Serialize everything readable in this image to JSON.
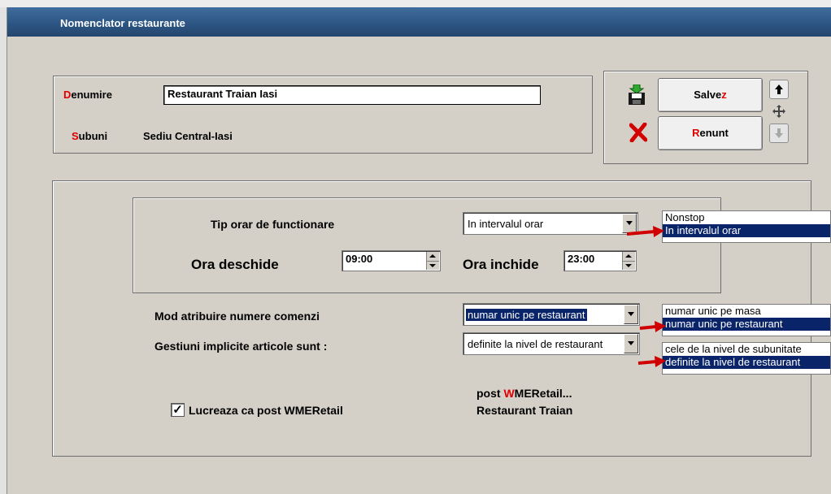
{
  "window": {
    "title": "Nomenclator restaurante"
  },
  "header": {
    "denumire_label_first": "D",
    "denumire_label_rest": "enumire",
    "denumire_value": "Restaurant Traian Iasi",
    "subuni_label_first": "S",
    "subuni_label_mid": "u",
    "subuni_label_rest": "buni",
    "subuni_value": "Sediu Central-Iasi"
  },
  "actions": {
    "save_label_main": "Salve",
    "save_label_hotkey": "z",
    "cancel_label_hotkey": "R",
    "cancel_label_main": "enunt"
  },
  "schedule": {
    "tip_orar_label": "Tip orar de functionare",
    "tip_orar_selected": "In intervalul orar",
    "tip_orar_options": [
      "Nonstop",
      "In intervalul orar"
    ],
    "ora_deschide_label": "Ora deschide",
    "ora_deschide_value": "09:00",
    "ora_inchide_label": "Ora inchide",
    "ora_inchide_value": "23:00"
  },
  "orders": {
    "mod_atribuire_label": "Mod atribuire numere comenzi",
    "mod_atribuire_selected": "numar unic pe restaurant",
    "mod_atribuire_options": [
      "numar unic pe masa",
      "numar unic pe restaurant"
    ],
    "gestiuni_label": "Gestiuni implicite articole sunt  :",
    "gestiuni_selected": "definite la nivel de restaurant",
    "gestiuni_options": [
      "cele de la nivel de subunitate",
      "definite la nivel de restaurant"
    ]
  },
  "post": {
    "checkbox_label": "Lucreaza ca post WMERetail",
    "checked": true,
    "info_prefix": "post ",
    "info_hotkey": "W",
    "info_rest": "MERetail...",
    "info_line2": "Restaurant Traian"
  },
  "colors": {
    "accent_red": "#e00000",
    "selection_blue": "#0a246a",
    "title_blue": "#2d5684",
    "panel_gray": "#d4d0c8"
  },
  "icons": [
    "save-disk-icon",
    "cancel-x-icon",
    "arrow-up-icon",
    "move-cross-icon",
    "arrow-down-icon",
    "red-arrow-icon",
    "checkmark-icon"
  ]
}
